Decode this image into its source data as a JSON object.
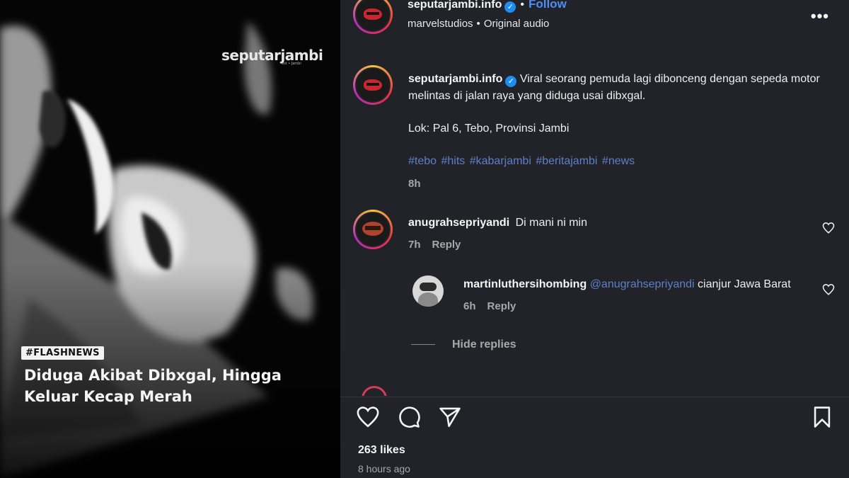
{
  "media": {
    "watermark": "seputarjambi",
    "watermark_sub": "est • Jambi",
    "flash_tag": "#FLASHNEWS",
    "headline": "Diduga Akibat Dibxgal, Hingga Keluar Kecap Merah"
  },
  "header": {
    "username": "seputarjambi.info",
    "verified_mark": "✓",
    "separator": "•",
    "follow_label": "Follow",
    "audio_owner": "marvelstudios",
    "audio_sep": "•",
    "audio_label": "Original audio",
    "more_icon": "•••"
  },
  "caption": {
    "username": "seputarjambi.info",
    "text": "Viral seorang pemuda lagi dibonceng dengan sepeda motor melintas di jalan raya yang diduga usai dibxgal.",
    "location": "Lok: Pal 6, Tebo, Provinsi Jambi",
    "hashtags": "#tebo #hits #kabarjambi #beritajambi #news",
    "time": "8h"
  },
  "comments": [
    {
      "username": "anugrahsepriyandi",
      "text": "Di mani ni min",
      "time": "7h",
      "reply_label": "Reply"
    }
  ],
  "replies": [
    {
      "username": "martinluthersihombing",
      "mention": "@anugrahsepriyandi",
      "text": "cianjur Jawa Barat",
      "time": "6h",
      "reply_label": "Reply"
    }
  ],
  "hide_replies_label": "Hide replies",
  "actions": {
    "icons": [
      "heart-icon",
      "comment-icon",
      "share-icon",
      "bookmark-icon"
    ]
  },
  "likes_label": "263 likes",
  "posted_ago": "8 hours ago",
  "colors": {
    "panel_bg": "#212328",
    "link_blue": "#4c8df6",
    "hashtag": "#5e7fc9",
    "muted": "#a8a8a8"
  }
}
